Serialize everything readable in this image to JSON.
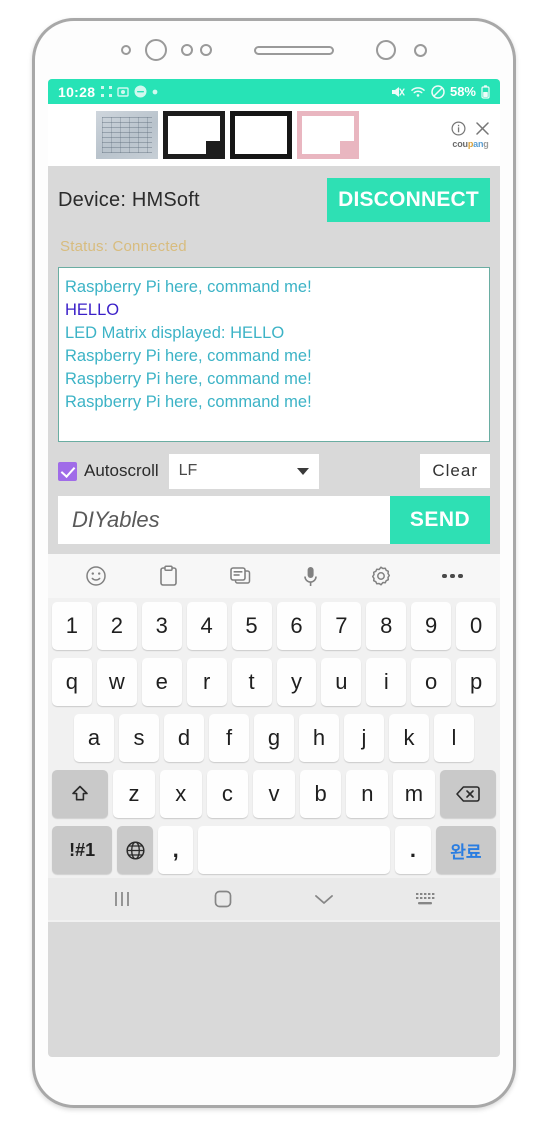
{
  "status_bar": {
    "time": "10:28",
    "battery_percent": "58%",
    "left_icons": [
      "dots-icon",
      "screenshot-icon",
      "message-icon",
      "dot-icon"
    ],
    "right_icons": [
      "mute-icon",
      "wifi-icon",
      "do-not-disturb-icon",
      "battery-icon"
    ]
  },
  "ad_banner": {
    "info_icon": "info-icon",
    "close_icon": "close-icon",
    "brand": {
      "p1": "cou",
      "p2": "p",
      "p3": "an",
      "p4": "g"
    },
    "thumbnails": [
      "circuit-board-thumbnail",
      "white-board-black-frame-thumbnail",
      "white-board-dark-frame-thumbnail",
      "white-board-pink-frame-thumbnail"
    ]
  },
  "app": {
    "device_label": "Device: HMSoft",
    "disconnect_label": "DISCONNECT",
    "status_text": "Status: Connected",
    "accent_color": "#2ee0b4",
    "status_color": "#d8bc7e",
    "log_lines": [
      {
        "text": "Raspberry Pi here, command me!",
        "dir": "rx"
      },
      {
        "text": "HELLO",
        "dir": "tx"
      },
      {
        "text": "LED Matrix displayed: HELLO",
        "dir": "rx"
      },
      {
        "text": "Raspberry Pi here, command me!",
        "dir": "rx"
      },
      {
        "text": "Raspberry Pi here, command me!",
        "dir": "rx"
      },
      {
        "text": "Raspberry Pi here, command me!",
        "dir": "rx"
      }
    ],
    "autoscroll_label": "Autoscroll",
    "autoscroll_checked": true,
    "line_ending_value": "LF",
    "clear_label": "Clear",
    "message_placeholder": "DIYables",
    "message_value": "",
    "send_label": "SEND"
  },
  "keyboard": {
    "toolbar_icons": [
      "emoji-icon",
      "clipboard-icon",
      "sticker-icon",
      "microphone-icon",
      "settings-icon",
      "more-icon"
    ],
    "row_numbers": [
      "1",
      "2",
      "3",
      "4",
      "5",
      "6",
      "7",
      "8",
      "9",
      "0"
    ],
    "row_letters1": [
      "q",
      "w",
      "e",
      "r",
      "t",
      "y",
      "u",
      "i",
      "o",
      "p"
    ],
    "row_letters2": [
      "a",
      "s",
      "d",
      "f",
      "g",
      "h",
      "j",
      "k",
      "l"
    ],
    "row_letters3": [
      "z",
      "x",
      "c",
      "v",
      "b",
      "n",
      "m"
    ],
    "shift_icon": "shift-icon",
    "backspace_icon": "backspace-icon",
    "symbols_label": "!#1",
    "language_icon": "globe-icon",
    "comma_label": ",",
    "space_label": "",
    "period_label": ".",
    "done_label": "완료"
  },
  "nav_bar": {
    "recents_icon": "recents-icon",
    "home_icon": "home-icon",
    "hide-keyboard_icon": "chevron-down-icon",
    "keyboard_switch_icon": "keyboard-switch-icon"
  }
}
